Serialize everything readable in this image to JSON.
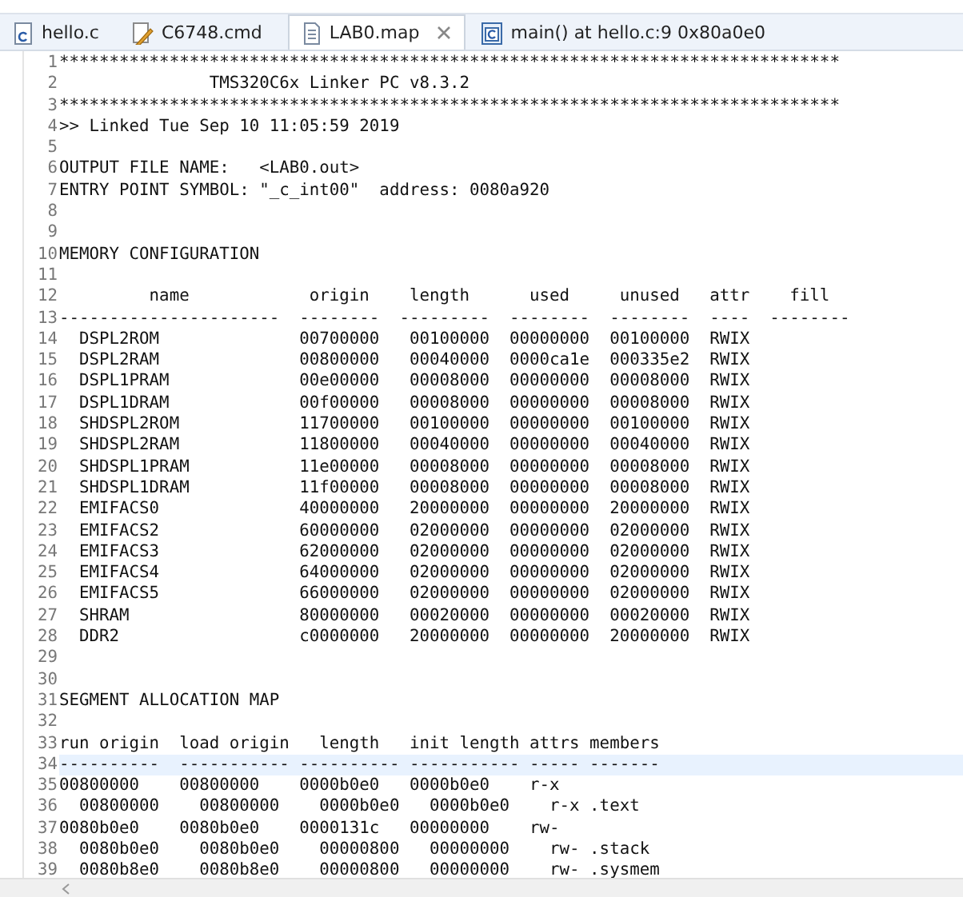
{
  "tabs": [
    {
      "label": "hello.c",
      "kind": "c-file",
      "selected": false
    },
    {
      "label": "C6748.cmd",
      "kind": "cmd-file",
      "selected": false
    },
    {
      "label": "LAB0.map",
      "kind": "text-file",
      "selected": true
    },
    {
      "label": "main() at hello.c:9 0x80a0e0",
      "kind": "debug-file",
      "selected": false
    }
  ],
  "editor": {
    "lines": [
      {
        "number": "1",
        "text": "******************************************************************************",
        "current": false
      },
      {
        "number": "2",
        "text": "               TMS320C6x Linker PC v8.3.2",
        "current": false
      },
      {
        "number": "3",
        "text": "******************************************************************************",
        "current": false
      },
      {
        "number": "4",
        "text": ">> Linked Tue Sep 10 11:05:59 2019",
        "current": false
      },
      {
        "number": "5",
        "current": false
      },
      {
        "number": "6",
        "text": "OUTPUT FILE NAME:   <LAB0.out>",
        "current": false
      },
      {
        "number": "7",
        "text": "ENTRY POINT SYMBOL: \"_c_int00\"  address: 0080a920",
        "current": false
      },
      {
        "number": "8",
        "current": false
      },
      {
        "number": "9",
        "current": false
      },
      {
        "number": "10",
        "text": "MEMORY CONFIGURATION",
        "current": false
      },
      {
        "number": "11",
        "current": false
      },
      {
        "number": "12",
        "text": "         name            origin    length      used     unused   attr    fill",
        "current": false
      },
      {
        "number": "13",
        "text": "----------------------  --------  ---------  --------  --------  ----  --------",
        "current": false
      },
      {
        "number": "14",
        "text": "  DSPL2ROM              00700000   00100000  00000000  00100000  RWIX",
        "current": false
      },
      {
        "number": "15",
        "text": "  DSPL2RAM              00800000   00040000  0000ca1e  000335e2  RWIX",
        "current": false
      },
      {
        "number": "16",
        "text": "  DSPL1PRAM             00e00000   00008000  00000000  00008000  RWIX",
        "current": false
      },
      {
        "number": "17",
        "text": "  DSPL1DRAM             00f00000   00008000  00000000  00008000  RWIX",
        "current": false
      },
      {
        "number": "18",
        "text": "  SHDSPL2ROM            11700000   00100000  00000000  00100000  RWIX",
        "current": false
      },
      {
        "number": "19",
        "text": "  SHDSPL2RAM            11800000   00040000  00000000  00040000  RWIX",
        "current": false
      },
      {
        "number": "20",
        "text": "  SHDSPL1PRAM           11e00000   00008000  00000000  00008000  RWIX",
        "current": false
      },
      {
        "number": "21",
        "text": "  SHDSPL1DRAM           11f00000   00008000  00000000  00008000  RWIX",
        "current": false
      },
      {
        "number": "22",
        "text": "  EMIFACS0              40000000   20000000  00000000  20000000  RWIX",
        "current": false
      },
      {
        "number": "23",
        "text": "  EMIFACS2              60000000   02000000  00000000  02000000  RWIX",
        "current": false
      },
      {
        "number": "24",
        "text": "  EMIFACS3              62000000   02000000  00000000  02000000  RWIX",
        "current": false
      },
      {
        "number": "25",
        "text": "  EMIFACS4              64000000   02000000  00000000  02000000  RWIX",
        "current": false
      },
      {
        "number": "26",
        "text": "  EMIFACS5              66000000   02000000  00000000  02000000  RWIX",
        "current": false
      },
      {
        "number": "27",
        "text": "  SHRAM                 80000000   00020000  00000000  00020000  RWIX",
        "current": false
      },
      {
        "number": "28",
        "text": "  DDR2                  c0000000   20000000  00000000  20000000  RWIX",
        "current": false
      },
      {
        "number": "29",
        "current": false
      },
      {
        "number": "30",
        "current": false
      },
      {
        "number": "31",
        "text": "SEGMENT ALLOCATION MAP",
        "current": false
      },
      {
        "number": "32",
        "current": false
      },
      {
        "number": "33",
        "text": "run origin  load origin   length   init length attrs members",
        "current": false
      },
      {
        "number": "34",
        "text": "----------  ----------- ---------- ----------- ----- -------",
        "current": true
      },
      {
        "number": "35",
        "text": "00800000    00800000    0000b0e0   0000b0e0    r-x",
        "current": false
      },
      {
        "number": "36",
        "text": "  00800000    00800000    0000b0e0   0000b0e0    r-x .text",
        "current": false
      },
      {
        "number": "37",
        "text": "0080b0e0    0080b0e0    0000131c   00000000    rw-",
        "current": false
      },
      {
        "number": "38",
        "text": "  0080b0e0    0080b0e0    00000800   00000000    rw- .stack",
        "current": false
      },
      {
        "number": "39",
        "text": "  0080b8e0    0080b8e0    00000800   00000000    rw- .sysmem",
        "current": false
      }
    ]
  }
}
